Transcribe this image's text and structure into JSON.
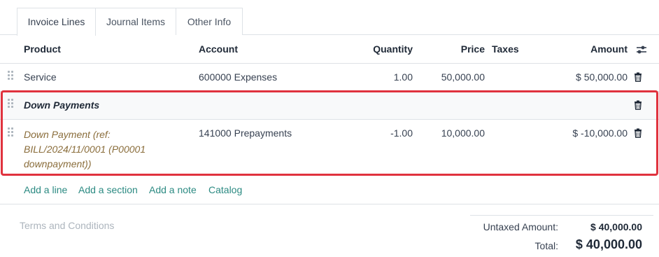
{
  "tabs": [
    {
      "label": "Invoice Lines",
      "active": true
    },
    {
      "label": "Journal Items",
      "active": false
    },
    {
      "label": "Other Info",
      "active": false
    }
  ],
  "columns": {
    "product": "Product",
    "account": "Account",
    "quantity": "Quantity",
    "price": "Price",
    "taxes": "Taxes",
    "amount": "Amount"
  },
  "lines": [
    {
      "product": "Service",
      "account": "600000 Expenses",
      "quantity": "1.00",
      "price": "50,000.00",
      "taxes": "",
      "amount": "$ 50,000.00"
    }
  ],
  "section": {
    "label": "Down Payments"
  },
  "downpayment_line": {
    "product_lines": [
      "Down Payment (ref:",
      "BILL/2024/11/0001 (P00001",
      "downpayment))"
    ],
    "account": "141000 Prepayments",
    "quantity": "-1.00",
    "price": "10,000.00",
    "taxes": "",
    "amount": "$ -10,000.00"
  },
  "actions": {
    "add_line": "Add a line",
    "add_section": "Add a section",
    "add_note": "Add a note",
    "catalog": "Catalog"
  },
  "terms_placeholder": "Terms and Conditions",
  "totals": {
    "untaxed_label": "Untaxed Amount:",
    "untaxed_value": "$ 40,000.00",
    "total_label": "Total:",
    "total_value": "$ 40,000.00"
  },
  "colors": {
    "link": "#2b8a82",
    "downpayment_text": "#8a6d3b",
    "highlight": "#e0323e"
  }
}
